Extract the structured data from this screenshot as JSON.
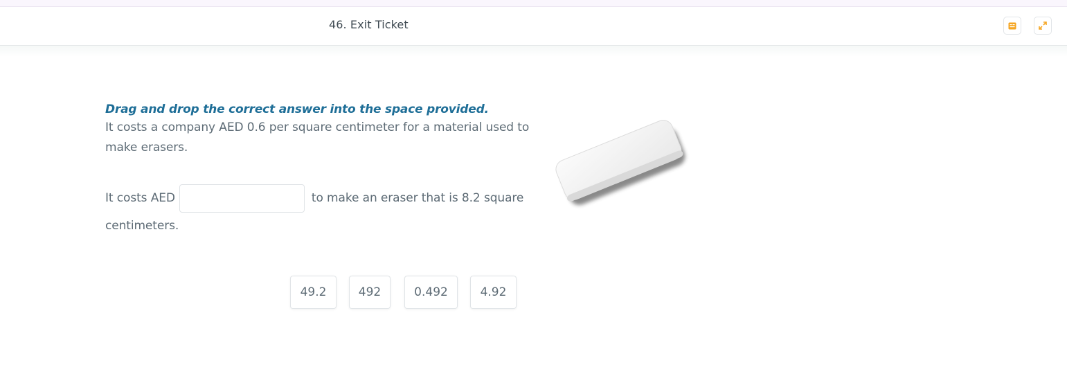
{
  "header": {
    "title": "46. Exit Ticket",
    "glossary_icon": "glossary-icon",
    "fullscreen_icon": "expand-icon",
    "accent_color": "#f5a623"
  },
  "question": {
    "instruction": "Drag and drop the correct answer into the space provided.",
    "prompt": "It costs a company AED 0.6 per square centimeter for a material used to make erasers.",
    "answer_prefix": "It costs AED",
    "answer_suffix": "to make an eraser that is 8.2 square",
    "answer_tail": "centimeters.",
    "drop_zone_value": ""
  },
  "choices": [
    "49.2",
    "492",
    "0.492",
    "4.92"
  ],
  "image": {
    "subject": "eraser-image"
  }
}
